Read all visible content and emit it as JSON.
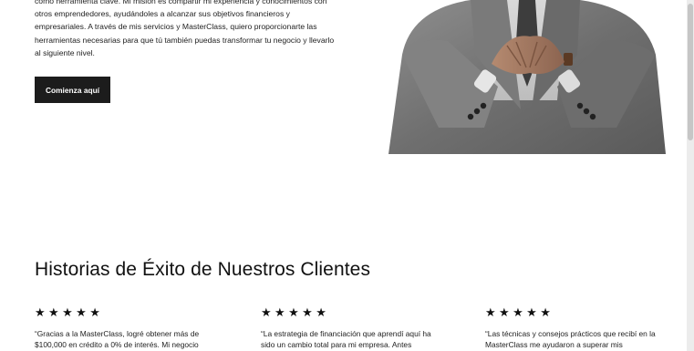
{
  "intro": {
    "paragraph": "como herramienta clave. Mi misión es compartir mi experiencia y conocimientos con otros emprendedores, ayudándoles a alcanzar sus objetivos financieros y empresariales. A través de mis servicios y MasterClass, quiero proporcionarte las herramientas necesarias para que tú también puedas transformar tu negocio y llevarlo al siguiente nivel.",
    "cta_label": "Comienza aquí"
  },
  "testimonials": {
    "title": "Historias de Éxito de Nuestros Clientes",
    "items": [
      {
        "stars": "★★★★★",
        "rating": 5,
        "text": "“Gracias a la MasterClass, logré obtener más de $100,000 en crédito a 0% de interés. Mi negocio"
      },
      {
        "stars": "★★★★★",
        "rating": 5,
        "text": "“La estrategia de financiación que aprendí aquí ha sido un cambio total para mi empresa. Antes"
      },
      {
        "stars": "★★★★★",
        "rating": 5,
        "text": "“Las técnicas y consejos prácticos que recibí en la MasterClass me ayudaron a superar mis"
      }
    ]
  },
  "colors": {
    "background": "#ffffff",
    "button": "#1c1c1c",
    "text": "#1a1a1a"
  }
}
